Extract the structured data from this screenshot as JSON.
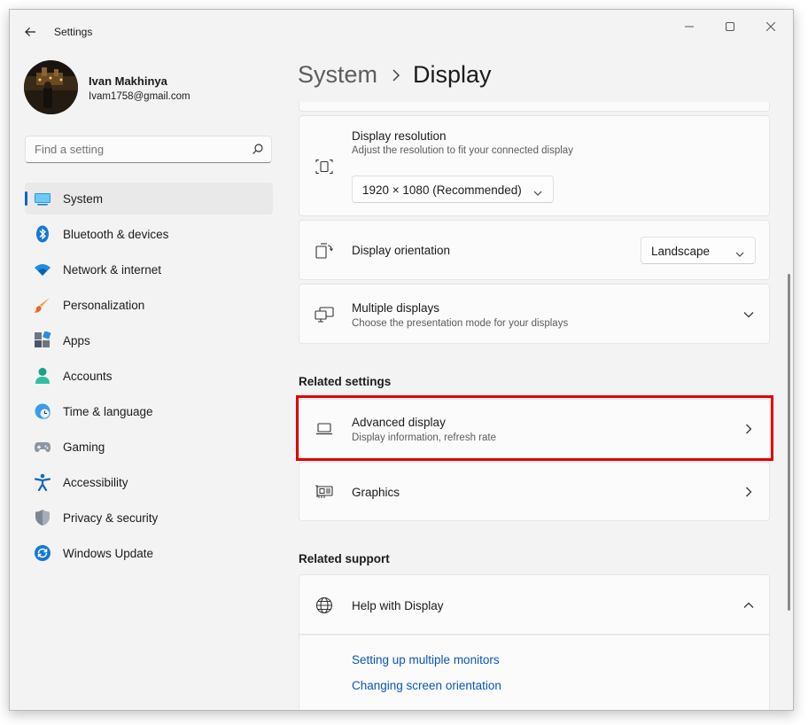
{
  "window": {
    "app_title": "Settings"
  },
  "user": {
    "name": "Ivan Makhinya",
    "email": "Ivam1758@gmail.com"
  },
  "search": {
    "placeholder": "Find a setting"
  },
  "nav": {
    "items": [
      {
        "label": "System",
        "icon": "display-icon",
        "active": true
      },
      {
        "label": "Bluetooth & devices",
        "icon": "bluetooth-icon"
      },
      {
        "label": "Network & internet",
        "icon": "wifi-icon"
      },
      {
        "label": "Personalization",
        "icon": "brush-icon"
      },
      {
        "label": "Apps",
        "icon": "apps-icon"
      },
      {
        "label": "Accounts",
        "icon": "person-icon"
      },
      {
        "label": "Time & language",
        "icon": "clock-globe-icon"
      },
      {
        "label": "Gaming",
        "icon": "gamepad-icon"
      },
      {
        "label": "Accessibility",
        "icon": "accessibility-icon"
      },
      {
        "label": "Privacy & security",
        "icon": "shield-icon"
      },
      {
        "label": "Windows Update",
        "icon": "update-icon"
      }
    ]
  },
  "breadcrumb": {
    "parent": "System",
    "current": "Display"
  },
  "cards": {
    "resolution": {
      "title": "Display resolution",
      "subtitle": "Adjust the resolution to fit your connected display",
      "value": "1920 × 1080 (Recommended)"
    },
    "orientation": {
      "title": "Display orientation",
      "value": "Landscape"
    },
    "multiple": {
      "title": "Multiple displays",
      "subtitle": "Choose the presentation mode for your displays"
    }
  },
  "related_settings": {
    "title": "Related settings",
    "advanced": {
      "title": "Advanced display",
      "subtitle": "Display information, refresh rate"
    },
    "graphics": {
      "title": "Graphics"
    }
  },
  "related_support": {
    "title": "Related support",
    "help": {
      "title": "Help with Display"
    },
    "links": [
      "Setting up multiple monitors",
      "Changing screen orientation"
    ]
  },
  "colors": {
    "accent": "#0067c0",
    "highlight": "#e00000",
    "link": "#0a56b5"
  }
}
